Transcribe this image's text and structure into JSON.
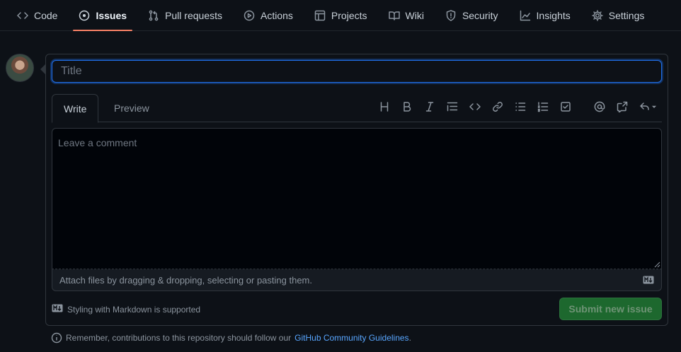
{
  "nav": {
    "items": [
      {
        "label": "Code",
        "icon": "code-icon"
      },
      {
        "label": "Issues",
        "icon": "issue-opened-icon",
        "selected": true
      },
      {
        "label": "Pull requests",
        "icon": "git-pull-request-icon"
      },
      {
        "label": "Actions",
        "icon": "play-icon"
      },
      {
        "label": "Projects",
        "icon": "table-icon"
      },
      {
        "label": "Wiki",
        "icon": "book-icon"
      },
      {
        "label": "Security",
        "icon": "shield-icon"
      },
      {
        "label": "Insights",
        "icon": "graph-icon"
      },
      {
        "label": "Settings",
        "icon": "gear-icon"
      }
    ]
  },
  "form": {
    "title_placeholder": "Title",
    "tabs": {
      "write": "Write",
      "preview": "Preview"
    },
    "toolbar": [
      "heading-icon",
      "bold-icon",
      "italic-icon",
      "quote-icon",
      "code-icon",
      "link-icon",
      "unordered-list-icon",
      "ordered-list-icon",
      "tasklist-icon",
      "mention-icon",
      "cross-reference-icon",
      "reply-icon"
    ],
    "comment_placeholder": "Leave a comment",
    "attach_text": "Attach files by dragging & dropping, selecting or pasting them.",
    "markdown_hint": "Styling with Markdown is supported",
    "submit_label": "Submit new issue"
  },
  "footer": {
    "prefix": "Remember, contributions to this repository should follow our",
    "link": "GitHub Community Guidelines",
    "suffix": "."
  },
  "colors": {
    "background": "#0d1117",
    "accent_underline": "#f78166",
    "focus_border": "#1f6feb",
    "submit_bg": "#238636",
    "link": "#58a6ff"
  }
}
